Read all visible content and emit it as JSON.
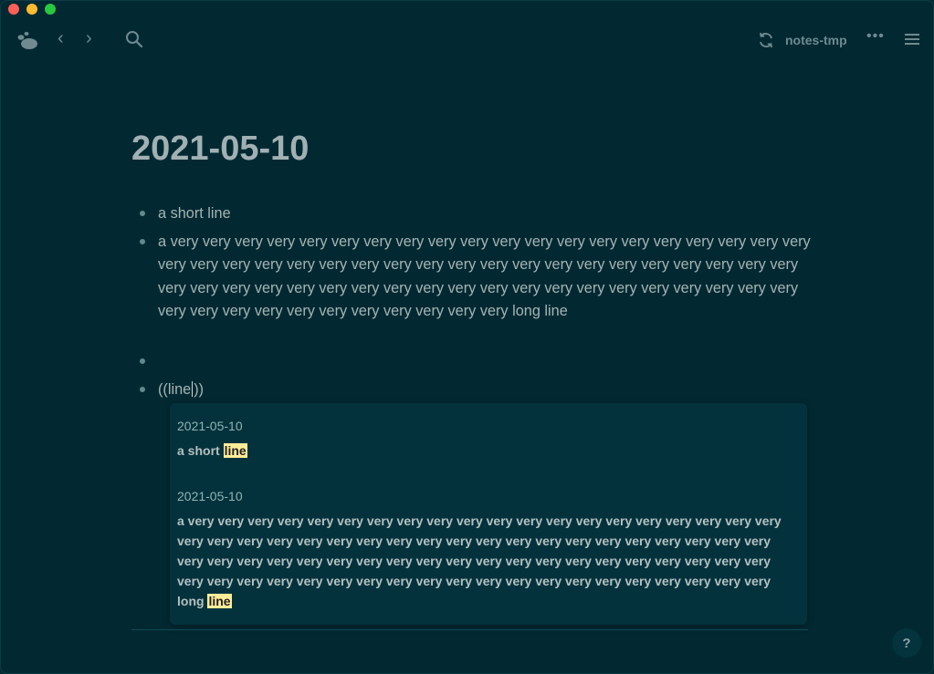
{
  "header": {
    "graph_name": "notes-tmp",
    "more_label": "•••",
    "back_label": "‹",
    "forward_label": "›"
  },
  "page": {
    "title": "2021-05-10"
  },
  "blocks": {
    "short_line": "a short line",
    "long_line": "a very very very very very very very very very very very very very very very very very very very very very very very very very very very very very very very very very very very very very very very very very very very very very very very very very very very very very very very very very very very very very very very very very very very very very very very long line",
    "empty": "",
    "ref_before_cursor": "((line",
    "ref_after_cursor": "))"
  },
  "search_popup": {
    "results": [
      {
        "page": "2021-05-10",
        "text_before": "a short ",
        "highlight": "line"
      },
      {
        "page": "2021-05-10",
        "text_before": "a very very very very very very very very very very very very very very very very very very very very very very very very very very very very very very very very very very very very very very very very very very very very very very very very very very very very very very very very very very very very very very very very very very very very very very very very very very very very very very very very long ",
        "highlight": "line"
      }
    ]
  },
  "help_label": "?",
  "colors": {
    "background": "#022932",
    "popup": "#03323c",
    "highlight": "#ffec99"
  }
}
